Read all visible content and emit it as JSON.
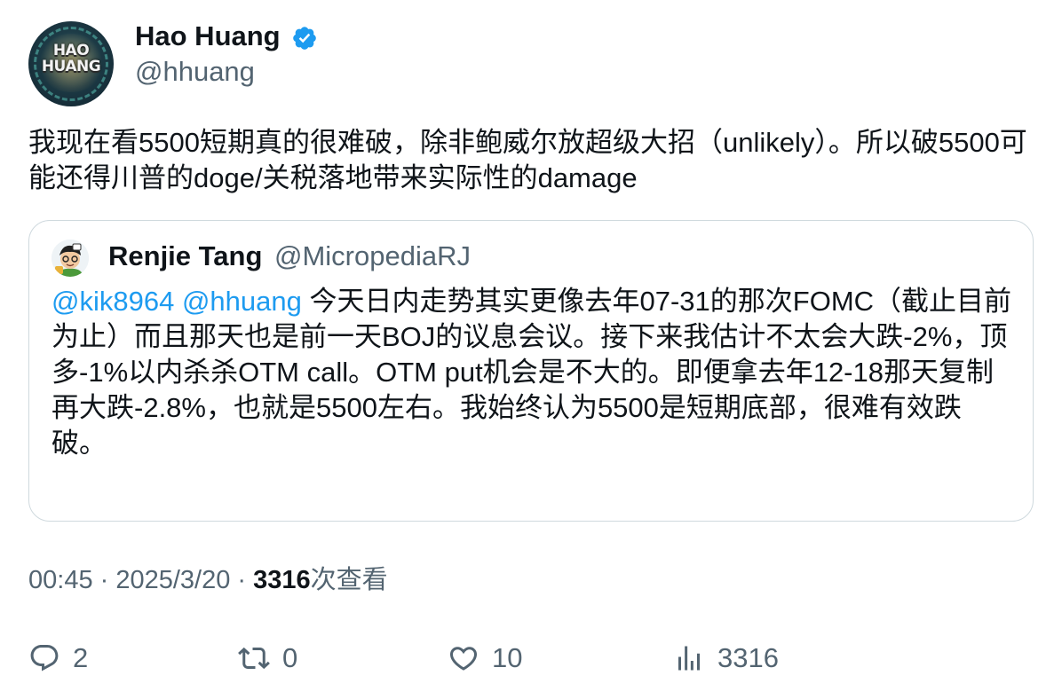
{
  "author": {
    "name": "Hao Huang",
    "handle": "@hhuang",
    "avatar_text_line1": "HAO",
    "avatar_text_line2": "HUANG",
    "verified_icon": "verified-badge-icon"
  },
  "tweet": {
    "text": "我现在看5500短期真的很难破，除非鲍威尔放超级大招（unlikely）。所以破5500可能还得川普的doge/关税落地带来实际性的damage"
  },
  "quoted_tweet": {
    "name": "Renjie Tang",
    "handle": "@MicropediaRJ",
    "mention_1": "@kik8964",
    "mention_2": "@hhuang",
    "text": " 今天日内走势其实更像去年07-31的那次FOMC（截止目前为止）而且那天也是前一天BOJ的议息会议。接下来我估计不太会大跌-2%，顶多-1%以内杀杀OTM call。OTM put机会是不大的。即便拿去年12-18那天复制再大跌-2.8%，也就是5500左右。我始终认为5500是短期底部，很难有效跌破。"
  },
  "meta": {
    "time": "00:45",
    "separator": " · ",
    "date": "2025/3/20",
    "views_count": "3316",
    "views_label": "次查看"
  },
  "actions": {
    "replies": "2",
    "reposts": "0",
    "likes": "10",
    "views": "3316"
  },
  "colors": {
    "text": "#0f1419",
    "secondary": "#536471",
    "link": "#1d9bf0",
    "border": "#cfd9de",
    "verified": "#1d9bf0"
  }
}
